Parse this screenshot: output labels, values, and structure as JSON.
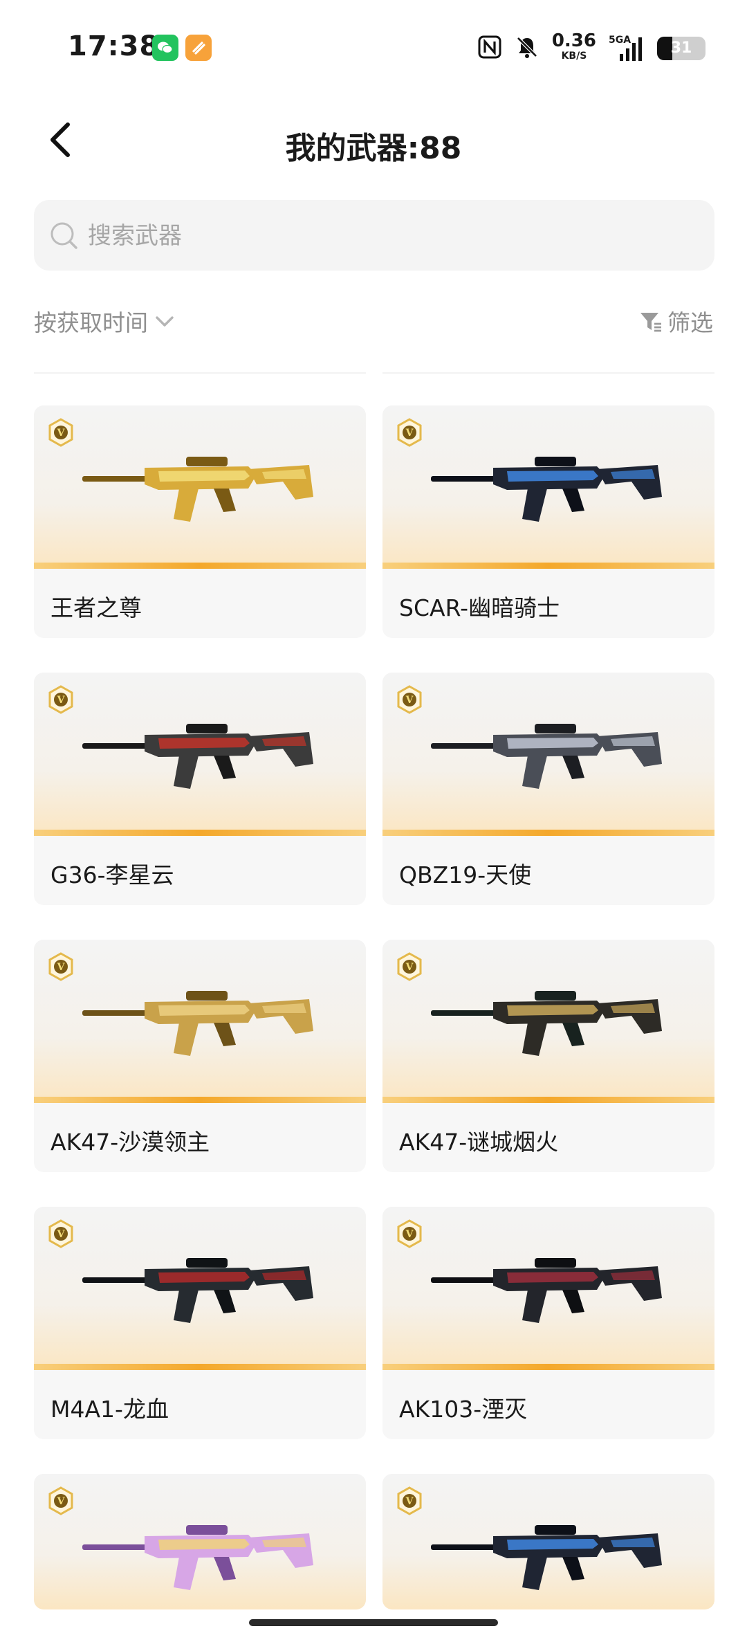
{
  "status_bar": {
    "time": "17:38",
    "net_speed_value": "0.36",
    "net_speed_unit": "KB/S",
    "network_type": "5GA",
    "battery_level": "31",
    "battery_percent": 31
  },
  "header": {
    "title": "我的武器:88"
  },
  "search": {
    "placeholder": "搜索武器"
  },
  "sort": {
    "label": "按获取时间"
  },
  "filter": {
    "label": "筛选"
  },
  "weapons": [
    {
      "name": "王者之尊",
      "palette": {
        "body": "#d8ab3a",
        "accent": "#f3dd7a",
        "dark": "#7a5a14"
      }
    },
    {
      "name": "SCAR-幽暗骑士",
      "palette": {
        "body": "#1f2533",
        "accent": "#3f86e0",
        "dark": "#0d1018"
      }
    },
    {
      "name": "G36-李星云",
      "palette": {
        "body": "#3b3b3b",
        "accent": "#c2342a",
        "dark": "#1a1a1a"
      }
    },
    {
      "name": "QBZ19-天使",
      "palette": {
        "body": "#4a4e57",
        "accent": "#bfc6d2",
        "dark": "#1c1e22"
      }
    },
    {
      "name": "AK47-沙漠领主",
      "palette": {
        "body": "#c9a24a",
        "accent": "#ecd083",
        "dark": "#6d5218"
      }
    },
    {
      "name": "AK47-谜城烟火",
      "palette": {
        "body": "#2d2b26",
        "accent": "#c9a85a",
        "dark": "#18221f"
      }
    },
    {
      "name": "M4A1-龙血",
      "palette": {
        "body": "#262b30",
        "accent": "#b02a2a",
        "dark": "#101316"
      }
    },
    {
      "name": "AK103-湮灭",
      "palette": {
        "body": "#23252b",
        "accent": "#9b2e3c",
        "dark": "#0e0f12"
      }
    },
    {
      "name": "",
      "palette": {
        "body": "#d7a6e6",
        "accent": "#f0d27a",
        "dark": "#7b4f9a"
      }
    },
    {
      "name": "",
      "palette": {
        "body": "#1f2533",
        "accent": "#3f86e0",
        "dark": "#0d1018"
      }
    }
  ]
}
